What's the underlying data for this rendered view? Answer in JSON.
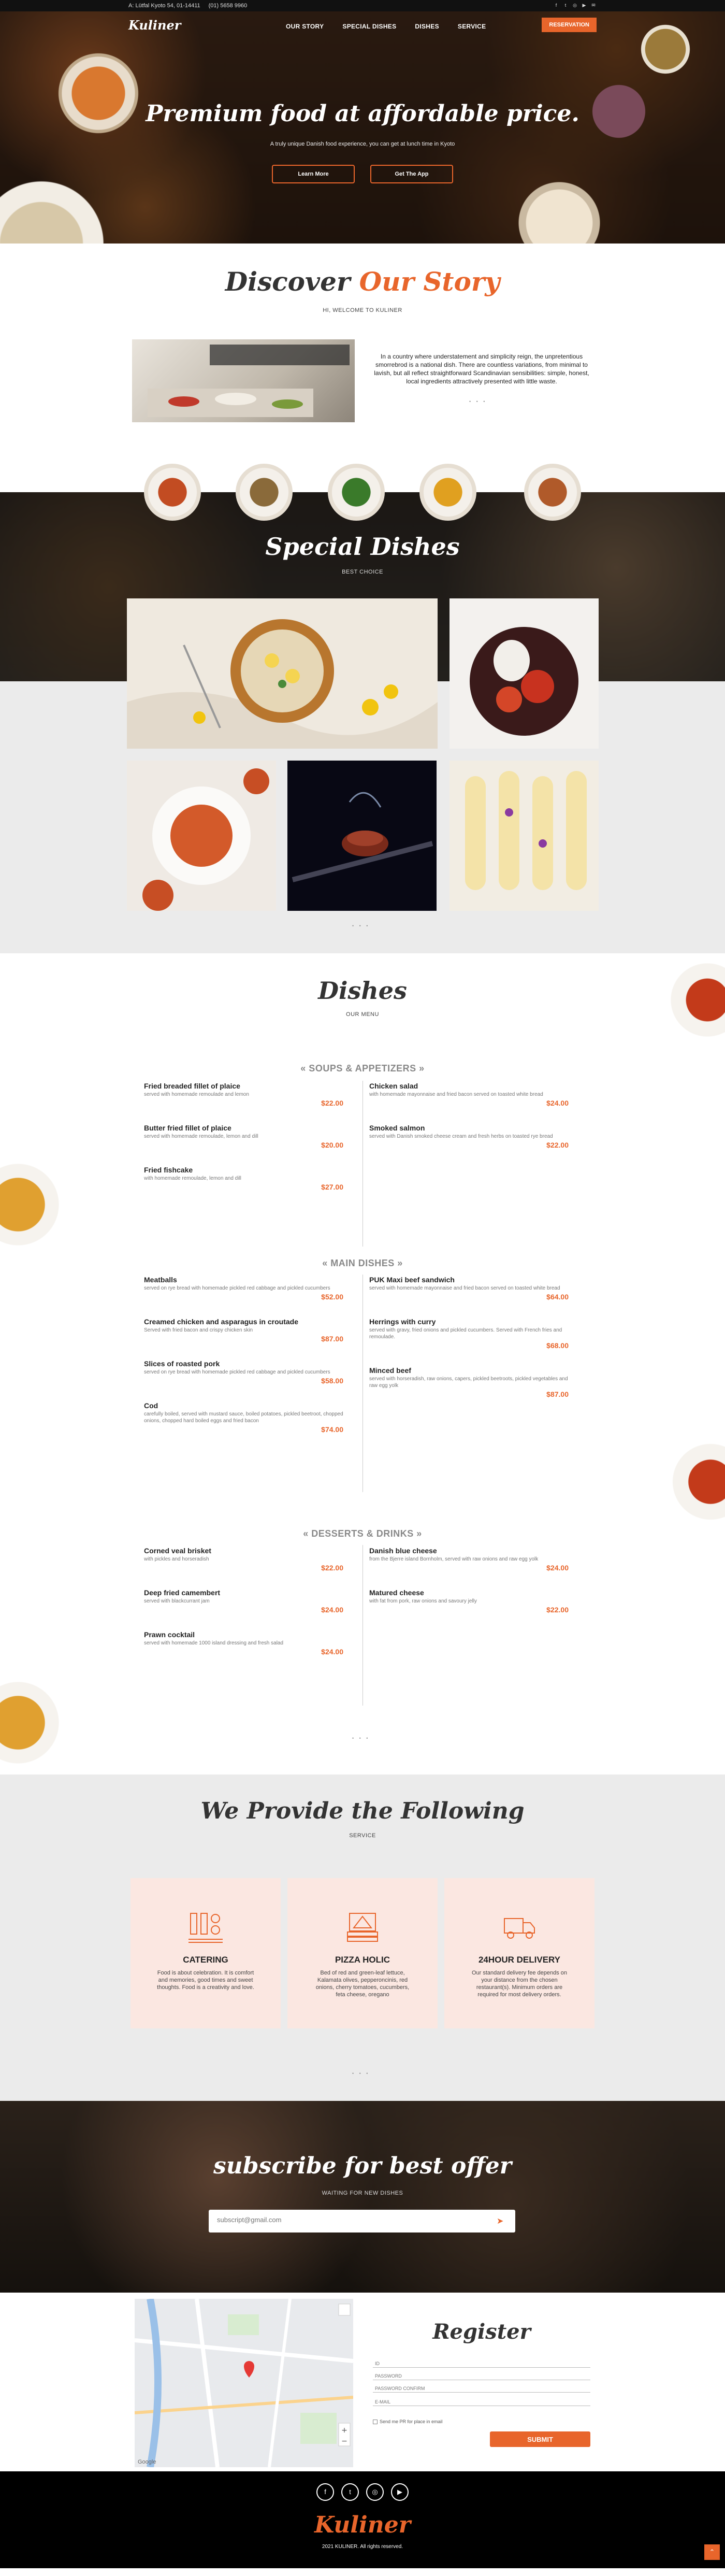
{
  "topbar": {
    "address": "A: Lütfal Kyoto 54, 01-14411",
    "phone": "(01) 5658 9960",
    "social_icons": [
      "facebook-icon",
      "twitter-icon",
      "instagram-icon",
      "youtube-icon",
      "email-icon"
    ]
  },
  "nav": {
    "logo": "Kuliner",
    "items": [
      "OUR STORY",
      "SPECIAL DISHES",
      "DISHES",
      "SERVICE"
    ],
    "reservation": "RESERVATION"
  },
  "hero": {
    "title": "Premium food at affordable price.",
    "subtitle": "A truly unique Danish food experience, you can get at lunch time in Kyoto",
    "btn_learn": "Learn More",
    "btn_app": "Get The App"
  },
  "story": {
    "title_a": "Discover",
    "title_b": "Our Story",
    "subtitle": "HI, WELCOME TO KULINER",
    "text": "In a country where understatement and simplicity reign, the unpretentious smorrebrod is a national dish. There are countless variations, from minimal to lavish, but all reflect straightforward Scandinavian sensibilities: simple, honest, local ingredients attractively presented with little waste."
  },
  "special": {
    "title": "Special Dishes",
    "subtitle": "BEST CHOICE"
  },
  "menu": {
    "title": "Dishes",
    "subtitle": "OUR MENU",
    "categories": [
      {
        "title": "« SOUPS & APPETIZERS »",
        "left": [
          {
            "name": "Fried breaded fillet of plaice",
            "desc": "served with homemade remoulade and lemon",
            "price": "$22.00"
          },
          {
            "name": "Butter fried fillet of plaice",
            "desc": "served with homemade remoulade, lemon and dill",
            "price": "$20.00"
          },
          {
            "name": "Fried fishcake",
            "desc": "with homemade remoulade, lemon and dill",
            "price": "$27.00"
          }
        ],
        "right": [
          {
            "name": "Chicken salad",
            "desc": "with homemade mayonnaise and fried bacon served on toasted white bread",
            "price": "$24.00"
          },
          {
            "name": "Smoked salmon",
            "desc": "served with Danish smoked cheese cream and fresh herbs on toasted rye bread",
            "price": "$22.00"
          }
        ]
      },
      {
        "title": "« MAIN DISHES »",
        "left": [
          {
            "name": "Meatballs",
            "desc": "served on rye bread with homemade pickled red cabbage and pickled cucumbers",
            "price": "$52.00"
          },
          {
            "name": "Creamed chicken and asparagus in croutade",
            "desc": "Served with fried bacon and crispy chicken skin",
            "price": "$87.00"
          },
          {
            "name": "Slices of roasted pork",
            "desc": "served on rye bread with homemade pickled red cabbage and pickled cucumbers",
            "price": "$58.00"
          },
          {
            "name": "Cod",
            "desc": "carefully boiled, served with mustard sauce, boiled potatoes, pickled beetroot, chopped onions, chopped hard boiled eggs and fried bacon",
            "price": "$74.00"
          }
        ],
        "right": [
          {
            "name": "PUK Maxi beef sandwich",
            "desc": "served with homemade mayonnaise and fried bacon served on toasted white bread",
            "price": "$64.00"
          },
          {
            "name": "Herrings with curry",
            "desc": "served with gravy, fried onions and pickled cucumbers. Served with French fries and remoulade.",
            "price": "$68.00"
          },
          {
            "name": "Minced beef",
            "desc": "served with horseradish, raw onions, capers, pickled beetroots, pickled vegetables and raw egg yolk",
            "price": "$87.00"
          }
        ]
      },
      {
        "title": "« DESSERTS & DRINKS »",
        "left": [
          {
            "name": "Corned veal brisket",
            "desc": "with pickles and horseradish",
            "price": "$22.00"
          },
          {
            "name": "Deep fried camembert",
            "desc": "served with blackcurrant jam",
            "price": "$24.00"
          },
          {
            "name": "Prawn cocktail",
            "desc": "served with homemade 1000 island dressing and fresh salad",
            "price": "$24.00"
          }
        ],
        "right": [
          {
            "name": "Danish blue cheese",
            "desc": "from the Bjerre island Bornholm, served with raw onions and raw egg yolk",
            "price": "$24.00"
          },
          {
            "name": "Matured cheese",
            "desc": "with fat from pork, raw onions and savoury jelly",
            "price": "$22.00"
          }
        ]
      }
    ]
  },
  "service": {
    "title": "We Provide the Following",
    "subtitle": "SERVICE",
    "cards": [
      {
        "title": "CATERING",
        "text": "Food is about celebration. It is comfort and memories, good times and sweet thoughts. Food is a creativity and love.",
        "icon": "catering-icon"
      },
      {
        "title": "PIZZA HOLIC",
        "text": "Bed of red and green-leaf lettuce, Kalamata olives, pepperoncinis, red onions, cherry tomatoes, cucumbers, feta cheese, oregano",
        "icon": "pizza-box-icon"
      },
      {
        "title": "24HOUR DELIVERY",
        "text": "Our standard delivery fee depends on your distance from the chosen restaurant(s). Minimum orders are required for most delivery orders.",
        "icon": "delivery-truck-icon"
      }
    ]
  },
  "subscribe": {
    "title": "subscribe for best offer",
    "subtitle": "WAITING FOR NEW DISHES",
    "placeholder": "subscript@gmail.com"
  },
  "register": {
    "title": "Register",
    "fields": [
      "ID",
      "PASSWORD",
      "PASSWORD CONFIRM",
      "E-MAIL"
    ],
    "checkbox": "Send me PR for place in email",
    "submit": "SUBMIT",
    "map_footer": "Google"
  },
  "footer": {
    "logo": "Kuliner",
    "copyright": "2021 KULINER. All rights reserved.",
    "social_icons": [
      "facebook-icon",
      "twitter-icon",
      "instagram-icon",
      "youtube-icon"
    ]
  },
  "colors": {
    "accent": "#e8652b",
    "dark": "#111111",
    "card": "#fbe7e1",
    "panel": "#ebebeb"
  }
}
